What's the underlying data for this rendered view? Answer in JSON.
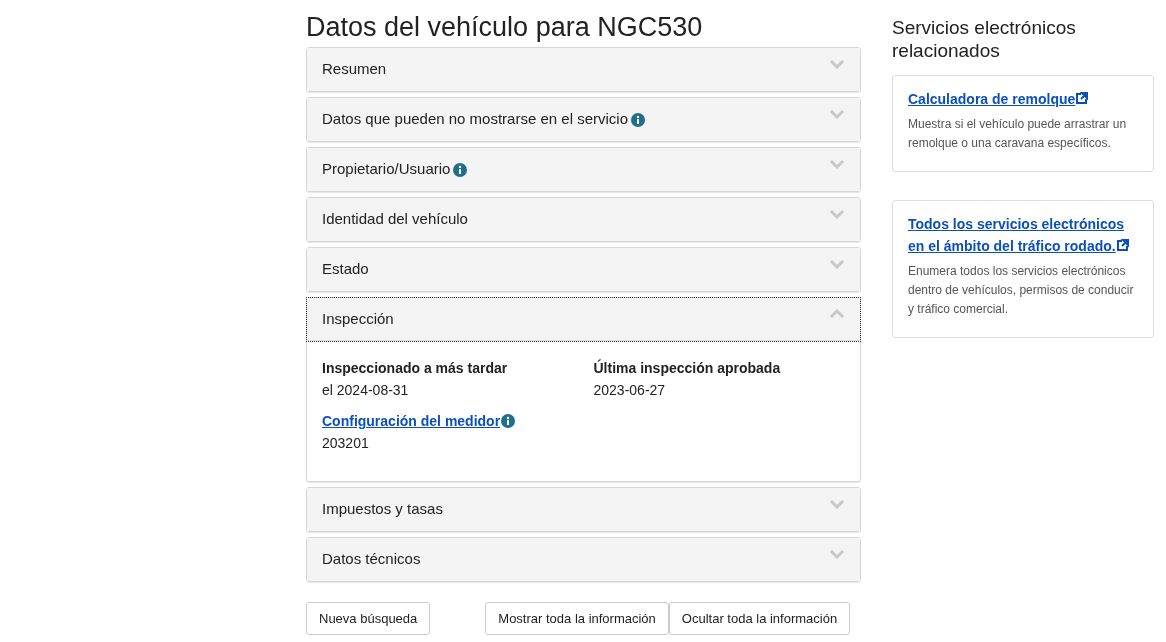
{
  "title": "Datos del vehículo para NGC530",
  "sections": [
    {
      "label": "Resumen",
      "info": false,
      "expanded": false
    },
    {
      "label": "Datos que pueden no mostrarse en el servicio",
      "info": true,
      "expanded": false
    },
    {
      "label": "Propietario/Usuario",
      "info": true,
      "expanded": false
    },
    {
      "label": "Identidad del vehículo",
      "info": false,
      "expanded": false
    },
    {
      "label": "Estado",
      "info": false,
      "expanded": false
    },
    {
      "label": "Inspección",
      "info": false,
      "expanded": true,
      "fields": [
        {
          "kind": "plain",
          "label": "Inspeccionado a más tardar",
          "value": "el 2024-08-31",
          "info": false
        },
        {
          "kind": "plain",
          "label": "Última inspección aprobada",
          "value": "2023-06-27",
          "info": false
        },
        {
          "kind": "link",
          "label": "Configuración del medidor",
          "value": "203201",
          "info": true
        }
      ]
    },
    {
      "label": "Impuestos y tasas",
      "info": false,
      "expanded": false
    },
    {
      "label": "Datos técnicos",
      "info": false,
      "expanded": false
    }
  ],
  "buttons": [
    "Nueva búsqueda",
    "Mostrar toda la información",
    "Ocultar toda la información"
  ],
  "sidebar": {
    "title": "Servicios electrónicos relacionados",
    "cards": [
      {
        "link": "Calculadora de remolque",
        "description": "Muestra si el vehículo puede arrastrar un remolque o una caravana específicos."
      },
      {
        "link": "Todos los servicios electrónicos en el ámbito del tráfico rodado.",
        "description": "Enumera todos los servicios electrónicos dentro de vehículos, permisos de conducir y tráfico comercial."
      }
    ]
  }
}
